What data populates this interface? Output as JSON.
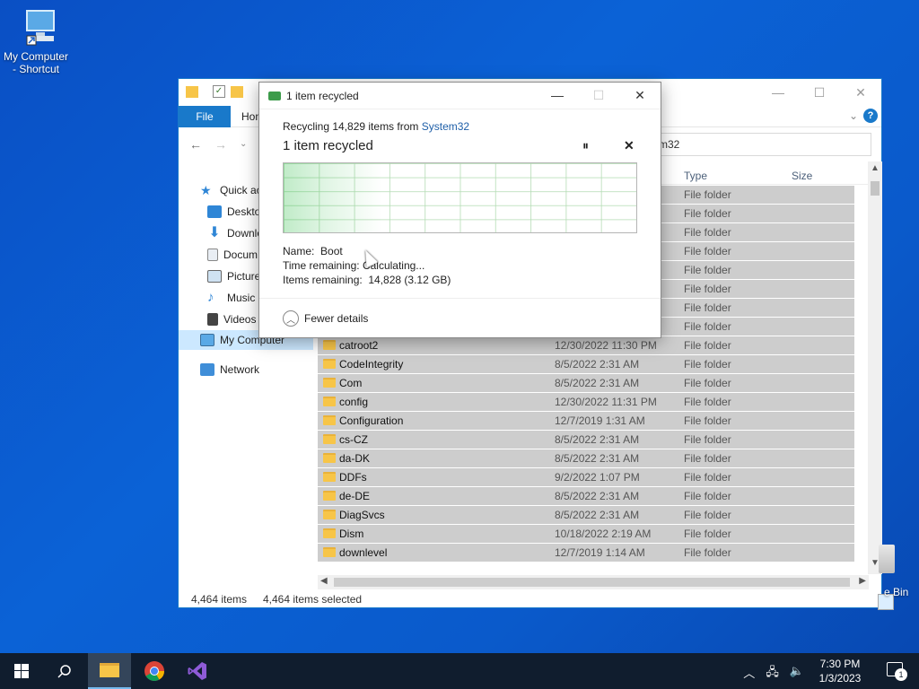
{
  "desktop": {
    "icons": [
      {
        "label_line1": "My Computer",
        "label_line2": "- Shortcut"
      }
    ],
    "recycle_bin_label_partial": "e Bin"
  },
  "explorer": {
    "ribbon": {
      "file_tab": "File",
      "home_tab": "Hon"
    },
    "address_partial": "m32",
    "columns": {
      "type": "Type",
      "size": "Size"
    },
    "sidebar": [
      {
        "label": "Quick ac",
        "icon": "star-icon"
      },
      {
        "label": "Desktop",
        "icon": "desktop-icon"
      },
      {
        "label": "Downlo",
        "icon": "download-icon"
      },
      {
        "label": "Docum",
        "icon": "document-icon"
      },
      {
        "label": "Picture",
        "icon": "picture-icon"
      },
      {
        "label": "Music",
        "icon": "music-icon"
      },
      {
        "label": "Videos",
        "icon": "video-icon"
      },
      {
        "label": "My Computer",
        "icon": "computer-icon"
      },
      {
        "label": "Network",
        "icon": "network-icon"
      }
    ],
    "rows": [
      {
        "name": "",
        "date": "",
        "type": "File folder"
      },
      {
        "name": "",
        "date": "",
        "type": "File folder"
      },
      {
        "name": "",
        "date": "",
        "type": "File folder"
      },
      {
        "name": "",
        "date": "",
        "type": "File folder"
      },
      {
        "name": "",
        "date": "",
        "type": "File folder"
      },
      {
        "name": "",
        "date": "",
        "type": "File folder"
      },
      {
        "name": "",
        "date": "",
        "type": "File folder"
      },
      {
        "name": "",
        "date": "",
        "type": "File folder"
      },
      {
        "name": "catroot2",
        "date": "12/30/2022 11:30 PM",
        "type": "File folder"
      },
      {
        "name": "CodeIntegrity",
        "date": "8/5/2022 2:31 AM",
        "type": "File folder"
      },
      {
        "name": "Com",
        "date": "8/5/2022 2:31 AM",
        "type": "File folder"
      },
      {
        "name": "config",
        "date": "12/30/2022 11:31 PM",
        "type": "File folder"
      },
      {
        "name": "Configuration",
        "date": "12/7/2019 1:31 AM",
        "type": "File folder"
      },
      {
        "name": "cs-CZ",
        "date": "8/5/2022 2:31 AM",
        "type": "File folder"
      },
      {
        "name": "da-DK",
        "date": "8/5/2022 2:31 AM",
        "type": "File folder"
      },
      {
        "name": "DDFs",
        "date": "9/2/2022 1:07 PM",
        "type": "File folder"
      },
      {
        "name": "de-DE",
        "date": "8/5/2022 2:31 AM",
        "type": "File folder"
      },
      {
        "name": "DiagSvcs",
        "date": "8/5/2022 2:31 AM",
        "type": "File folder"
      },
      {
        "name": "Dism",
        "date": "10/18/2022 2:19 AM",
        "type": "File folder"
      },
      {
        "name": "downlevel",
        "date": "12/7/2019 1:14 AM",
        "type": "File folder"
      }
    ],
    "status": {
      "item_count": "4,464 items",
      "selected": "4,464 items selected"
    }
  },
  "dialog": {
    "title": "1 item recycled",
    "recycling_prefix": "Recycling 14,829 items from ",
    "source": "System32",
    "big_status": "1 item recycled",
    "pause_glyph": "⏸",
    "close_glyph": "✕",
    "name_label": "Name:",
    "name_value": "Boot",
    "time_label": "Time remaining:",
    "time_value": "Calculating...",
    "items_label": "Items remaining:",
    "items_value": "14,828 (3.12 GB)",
    "fewer_details": "Fewer details",
    "progress_fraction": 0.0
  },
  "taskbar": {
    "time": "7:30 PM",
    "date": "1/3/2023",
    "notif_count": "1"
  }
}
